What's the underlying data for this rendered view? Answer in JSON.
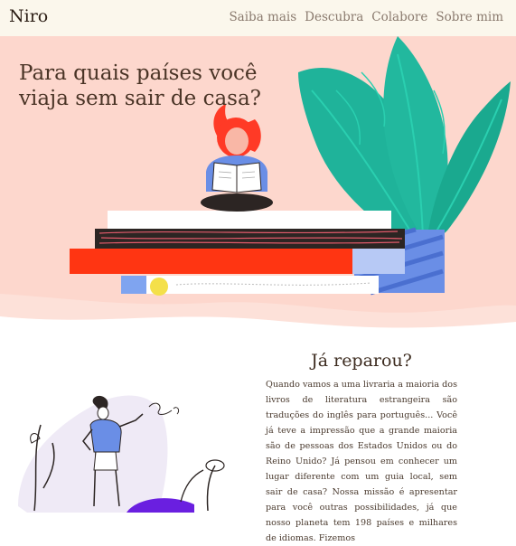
{
  "nav": {
    "brand": "Niro",
    "links": [
      "Saiba mais",
      "Descubra",
      "Colabore",
      "Sobre mim"
    ]
  },
  "hero": {
    "title": "Para quais países você viaja sem sair de casa?",
    "background": "#fdd7cd"
  },
  "section2": {
    "title": "Já reparou?",
    "text": "Quando vamos a uma livraria a maioria dos livros de literatura estrangeira são traduções do inglês para português... Você já teve a impressão que a grande maioria são de pessoas dos Estados Unidos ou do Reino Unido? Já pensou em conhecer um lugar diferente com um guia local, sem sair de casa? Nossa missão é apresentar para você outras possibilidades, já que nosso planeta tem 198 países e milhares de idiomas. Fizemos"
  },
  "colors": {
    "nav_bg": "#fbf7ec",
    "leaf": "#1fb39a",
    "book_red": "#ff3512",
    "book_dark": "#2c2523",
    "hair": "#ff3a26",
    "pot_blue": "#6a8ee6",
    "accent_purple": "#6a1fe0"
  }
}
